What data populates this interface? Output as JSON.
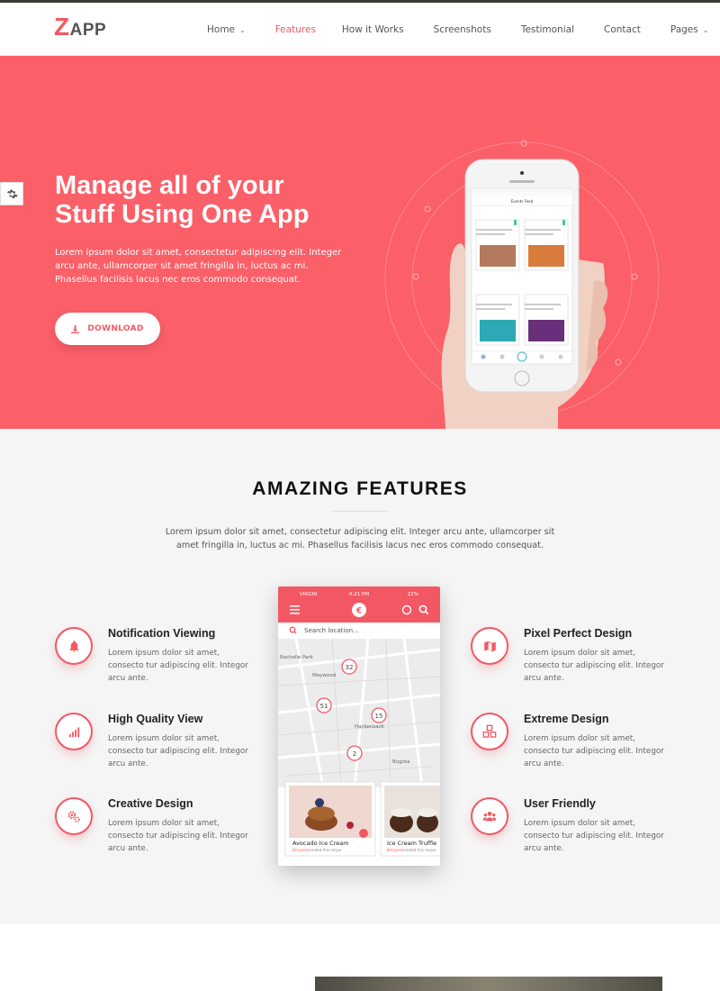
{
  "brand": {
    "logo_initial": "Z",
    "logo_rest": "APP",
    "accent": "#f25864"
  },
  "nav": [
    {
      "label": "Home",
      "dropdown": true,
      "active": false
    },
    {
      "label": "Features",
      "dropdown": false,
      "active": true
    },
    {
      "label": "How it Works",
      "dropdown": false,
      "active": false
    },
    {
      "label": "Screenshots",
      "dropdown": false,
      "active": false
    },
    {
      "label": "Testimonial",
      "dropdown": false,
      "active": false
    },
    {
      "label": "Contact",
      "dropdown": false,
      "active": false
    },
    {
      "label": "Pages",
      "dropdown": true,
      "active": false
    }
  ],
  "hero": {
    "title_line1": "Manage all of your",
    "title_line2": "Stuff Using One App",
    "text": "Lorem ipsum dolor sit amet, consectetur adipiscing elit. Integer arcu ante, ullamcorper sit amet fringilla in, luctus ac mi. Phasellus facilisis lacus nec eros commodo consequat.",
    "download_label": "DOWNLOAD",
    "bg_color": "#fb5f68",
    "phone": {
      "header": "Events Feed",
      "cards": [
        {
          "title": "Let's Celebrate Happy Valentines day"
        },
        {
          "title": "It's a Carnival in the European Winter"
        },
        {
          "title": "Winter Party Sea Beach Cocktale"
        },
        {
          "title": "It's a Conference & Build an Innovative Creative Career"
        }
      ]
    }
  },
  "features": {
    "heading": "AMAZING FEATURES",
    "lead": "Lorem ipsum dolor sit amet, consectetur adipiscing elit. Integer arcu ante, ullamcorper sit amet fringilla in, luctus ac mi. Phasellus facilisis lacus nec eros commodo consequat.",
    "left": [
      {
        "title": "Notification Viewing",
        "desc": "Lorem ipsum dolor sit amet, consecto tur adipiscing elit. Integor arcu ante.",
        "icon": "bell-icon"
      },
      {
        "title": "High Quality View",
        "desc": "Lorem ipsum dolor sit amet, consecto tur adipiscing elit. Integor arcu ante.",
        "icon": "signal-bars-icon"
      },
      {
        "title": "Creative Design",
        "desc": "Lorem ipsum dolor sit amet, consecto tur adipiscing elit. Integor arcu ante.",
        "icon": "gears-icon"
      }
    ],
    "right": [
      {
        "title": "Pixel Perfect Design",
        "desc": "Lorem ipsum dolor sit amet, consecto tur adipiscing elit. Integor arcu ante.",
        "icon": "map-icon"
      },
      {
        "title": "Extreme Design",
        "desc": "Lorem ipsum dolor sit amet, consecto tur adipiscing elit. Integor arcu ante.",
        "icon": "cubes-icon"
      },
      {
        "title": "User Friendly",
        "desc": "Lorem ipsum dolor sit amet, consecto tur adipiscing elit. Integor arcu ante.",
        "icon": "users-icon"
      }
    ],
    "phone": {
      "carrier": "VIRGIN",
      "time": "4:21 PM",
      "battery": "22%",
      "search_placeholder": "Search location...",
      "map_labels": [
        "Rochelle Park",
        "Maywood",
        "Hackensack",
        "Bogota"
      ],
      "pins": [
        "32",
        "51",
        "15",
        "2"
      ],
      "cards": [
        {
          "title": "Avocado Ice Cream",
          "sub_link": "Bricyann",
          "sub_text": "created this recipe"
        },
        {
          "title": "Ice Cream Truffle",
          "sub_link": "Bricyann",
          "sub_text": "created this recipe"
        }
      ]
    }
  }
}
